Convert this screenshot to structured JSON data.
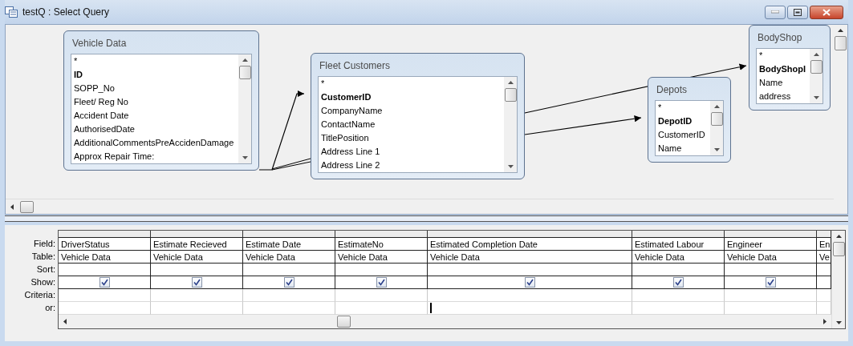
{
  "window": {
    "title": "testQ : Select Query"
  },
  "tables": [
    {
      "title": "Vehicle Data",
      "fields": [
        {
          "name": "*",
          "key": false
        },
        {
          "name": "ID",
          "key": true
        },
        {
          "name": "SOPP_No",
          "key": false
        },
        {
          "name": "Fleet/ Reg No",
          "key": false
        },
        {
          "name": "Accident Date",
          "key": false
        },
        {
          "name": "AuthorisedDate",
          "key": false
        },
        {
          "name": "AdditionalCommentsPreAccidenDamage",
          "key": false
        },
        {
          "name": "Approx Repair Time:",
          "key": false
        }
      ]
    },
    {
      "title": "Fleet Customers",
      "fields": [
        {
          "name": "*",
          "key": false
        },
        {
          "name": "CustomerID",
          "key": true
        },
        {
          "name": "CompanyName",
          "key": false
        },
        {
          "name": "ContactName",
          "key": false
        },
        {
          "name": "TitlePosition",
          "key": false
        },
        {
          "name": "Address Line 1",
          "key": false
        },
        {
          "name": "Address Line 2",
          "key": false
        }
      ]
    },
    {
      "title": "Depots",
      "fields": [
        {
          "name": "*",
          "key": false
        },
        {
          "name": "DepotID",
          "key": true
        },
        {
          "name": "CustomerID",
          "key": false
        },
        {
          "name": "Name",
          "key": false
        }
      ]
    },
    {
      "title": "BodyShop",
      "fields": [
        {
          "name": "*",
          "key": false
        },
        {
          "name": "BodyShopI",
          "key": true
        },
        {
          "name": "Name",
          "key": false
        },
        {
          "name": "address",
          "key": false
        }
      ]
    }
  ],
  "grid": {
    "row_labels": [
      "Field:",
      "Table:",
      "Sort:",
      "Show:",
      "Criteria:",
      "or:"
    ],
    "columns": [
      {
        "field": "DriverStatus",
        "table": "Vehicle Data",
        "show": true,
        "focused": false
      },
      {
        "field": "Estimate Recieved",
        "table": "Vehicle Data",
        "show": true,
        "focused": false
      },
      {
        "field": "Estimate Date",
        "table": "Vehicle Data",
        "show": true,
        "focused": false
      },
      {
        "field": "EstimateNo",
        "table": "Vehicle Data",
        "show": true,
        "focused": false
      },
      {
        "field": "Estimated Completion Date",
        "table": "Vehicle Data",
        "show": true,
        "focused": true
      },
      {
        "field": "Estimated Labour",
        "table": "Vehicle Data",
        "show": true,
        "focused": false
      },
      {
        "field": "Engineer",
        "table": "Vehicle Data",
        "show": true,
        "focused": false
      },
      {
        "field": "En",
        "table": "Ve",
        "focused": false
      }
    ]
  }
}
